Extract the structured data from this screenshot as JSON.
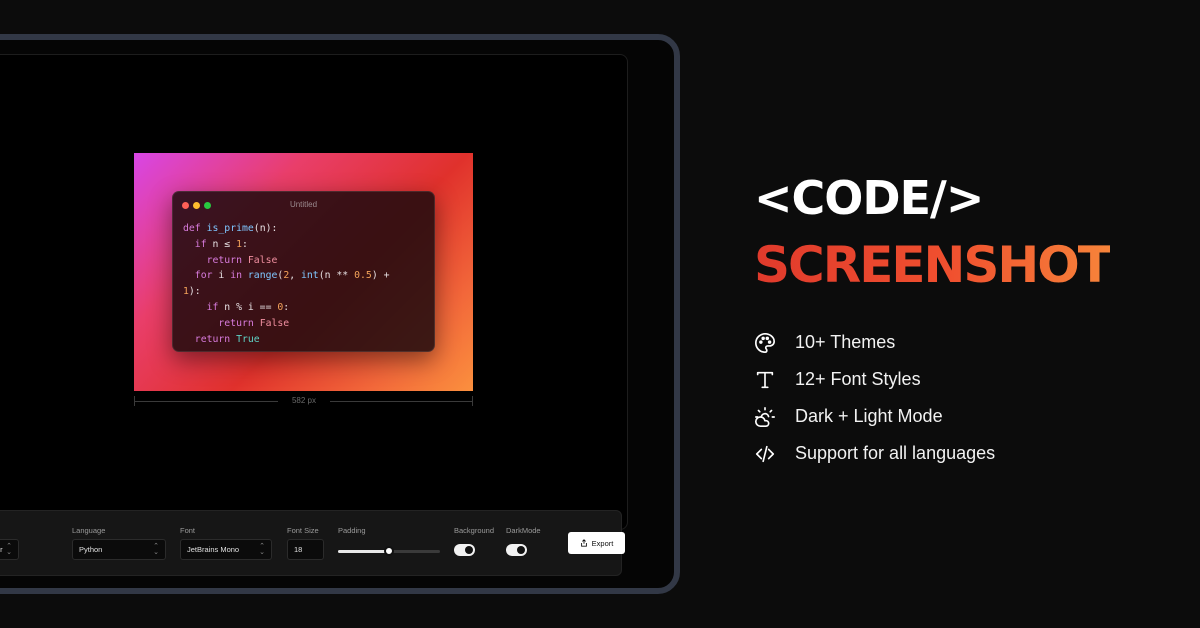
{
  "preview": {
    "window_title": "Untitled",
    "code_lines": [
      "def is_prime(n):",
      "  if n ≤ 1:",
      "    return False",
      "  for i in range(2, int(n ** 0.5) +",
      "1):",
      "    if n % i == 0:",
      "      return False",
      "  return True"
    ],
    "width_label": "582 px",
    "gradient_colors": [
      "#d846e6",
      "#e93e6a",
      "#e0312c",
      "#fb903e"
    ]
  },
  "toolbar": {
    "theme": {
      "value": "er"
    },
    "language": {
      "label": "Language",
      "value": "Python"
    },
    "font": {
      "label": "Font",
      "value": "JetBrains Mono"
    },
    "font_size": {
      "label": "Font Size",
      "value": "18"
    },
    "padding": {
      "label": "Padding",
      "level": 0.5
    },
    "background": {
      "label": "Background",
      "on": true
    },
    "dark_mode": {
      "label": "DarkMode",
      "on": true
    },
    "export_label": "Export"
  },
  "hero": {
    "title": "<CODE/>",
    "subtitle": "SCREENSHOT",
    "accent_colors": [
      "#e03a2c",
      "#f7843a"
    ],
    "features": [
      {
        "icon": "palette-icon",
        "text": "10+ Themes"
      },
      {
        "icon": "text-type-icon",
        "text": "12+ Font Styles"
      },
      {
        "icon": "sun-cloud-icon",
        "text": "Dark + Light Mode"
      },
      {
        "icon": "code-icon",
        "text": "Support for all languages"
      }
    ]
  }
}
